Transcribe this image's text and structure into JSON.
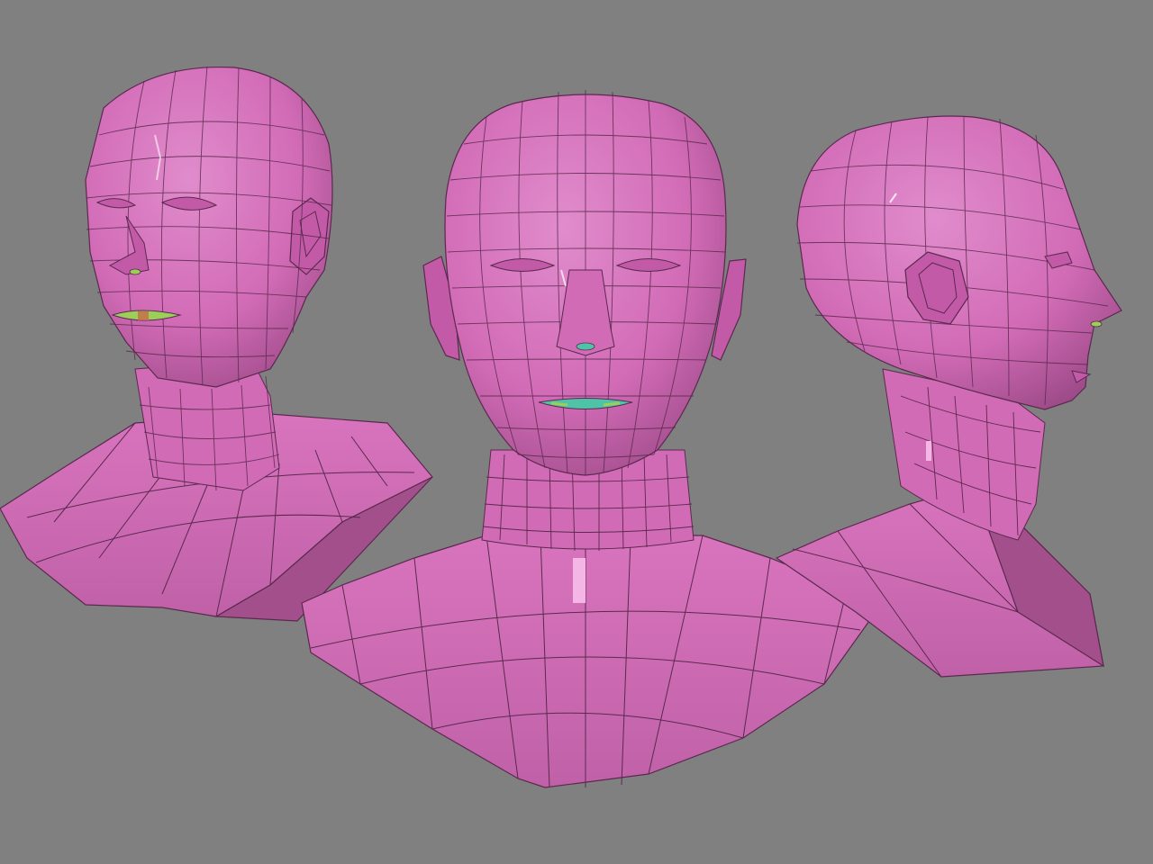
{
  "scene": {
    "background_color": "#808080",
    "mesh_color": "#d26bb6",
    "mesh_shadow_color": "#a24f8c",
    "mesh_highlight_color": "#e585cd",
    "wire_color": "#5a2a4e",
    "mouth_colors": [
      "#4fc3a8",
      "#9ccf5a",
      "#c86a4a"
    ],
    "views": [
      {
        "name": "three-quarter"
      },
      {
        "name": "front"
      },
      {
        "name": "profile"
      }
    ]
  }
}
